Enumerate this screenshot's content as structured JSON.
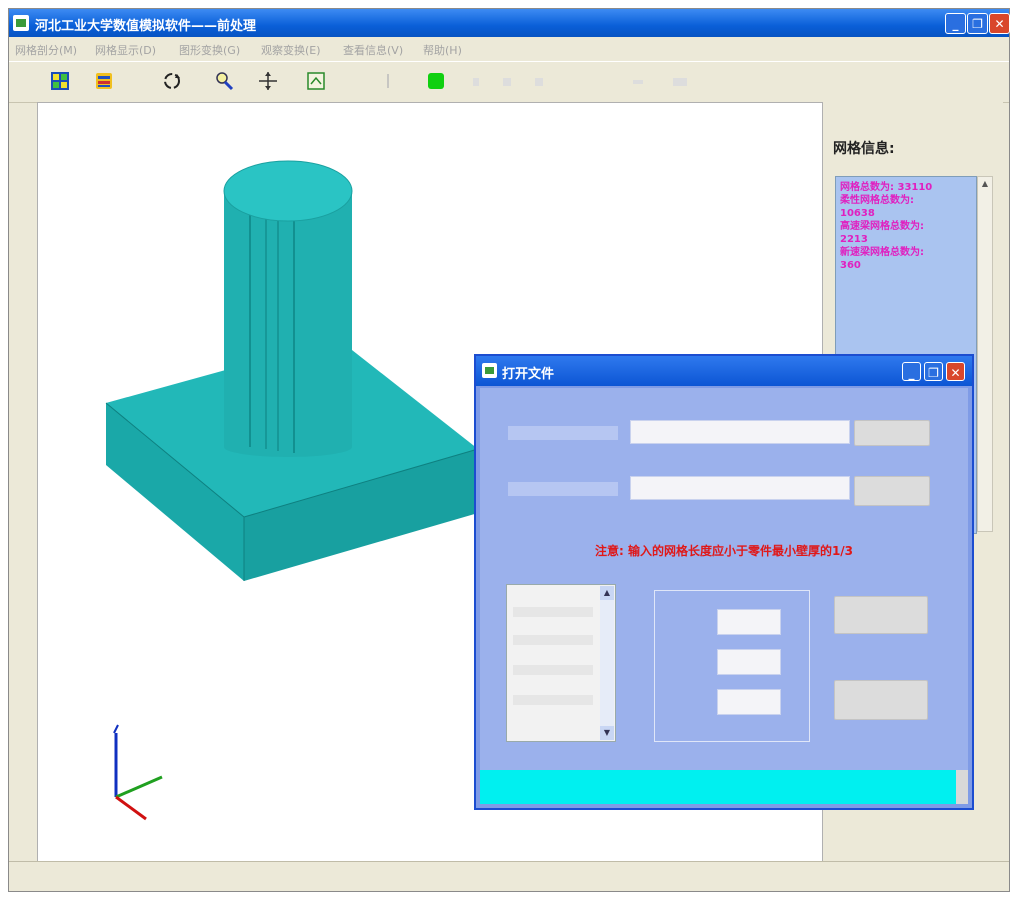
{
  "window": {
    "title": "河北工业大学数值模拟软件——前处理"
  },
  "menu": [
    "网格剖分(M)",
    "网格显示(D)",
    "图形变换(G)",
    "观察变换(E)",
    "查看信息(V)",
    "帮助(H)"
  ],
  "toolbar_icons": [
    "grid-icon",
    "layers-icon",
    "rotate-icon",
    "zoom-icon",
    "pan-icon",
    "fit-view-icon",
    "cursor-icon",
    "green-square-icon"
  ],
  "colors": {
    "model": "#20b0b0",
    "model_dark": "#139a9a",
    "mesh_text": "#e020c0",
    "note": "#e01818",
    "dialog_bg": "#9bb1ec",
    "status_cyan": "#00f0f0"
  },
  "mesh_panel": {
    "title": "网格信息:",
    "lines": [
      "网格总数为: 33110",
      "柔性网格总数为:",
      "10638",
      "高速梁网格总数为:",
      "2213",
      "新速梁网格总数为:",
      "360"
    ]
  },
  "dialog": {
    "title": "打开文件",
    "note": "注意: 输入的网格长度应小于零件最小壁厚的1/3"
  }
}
